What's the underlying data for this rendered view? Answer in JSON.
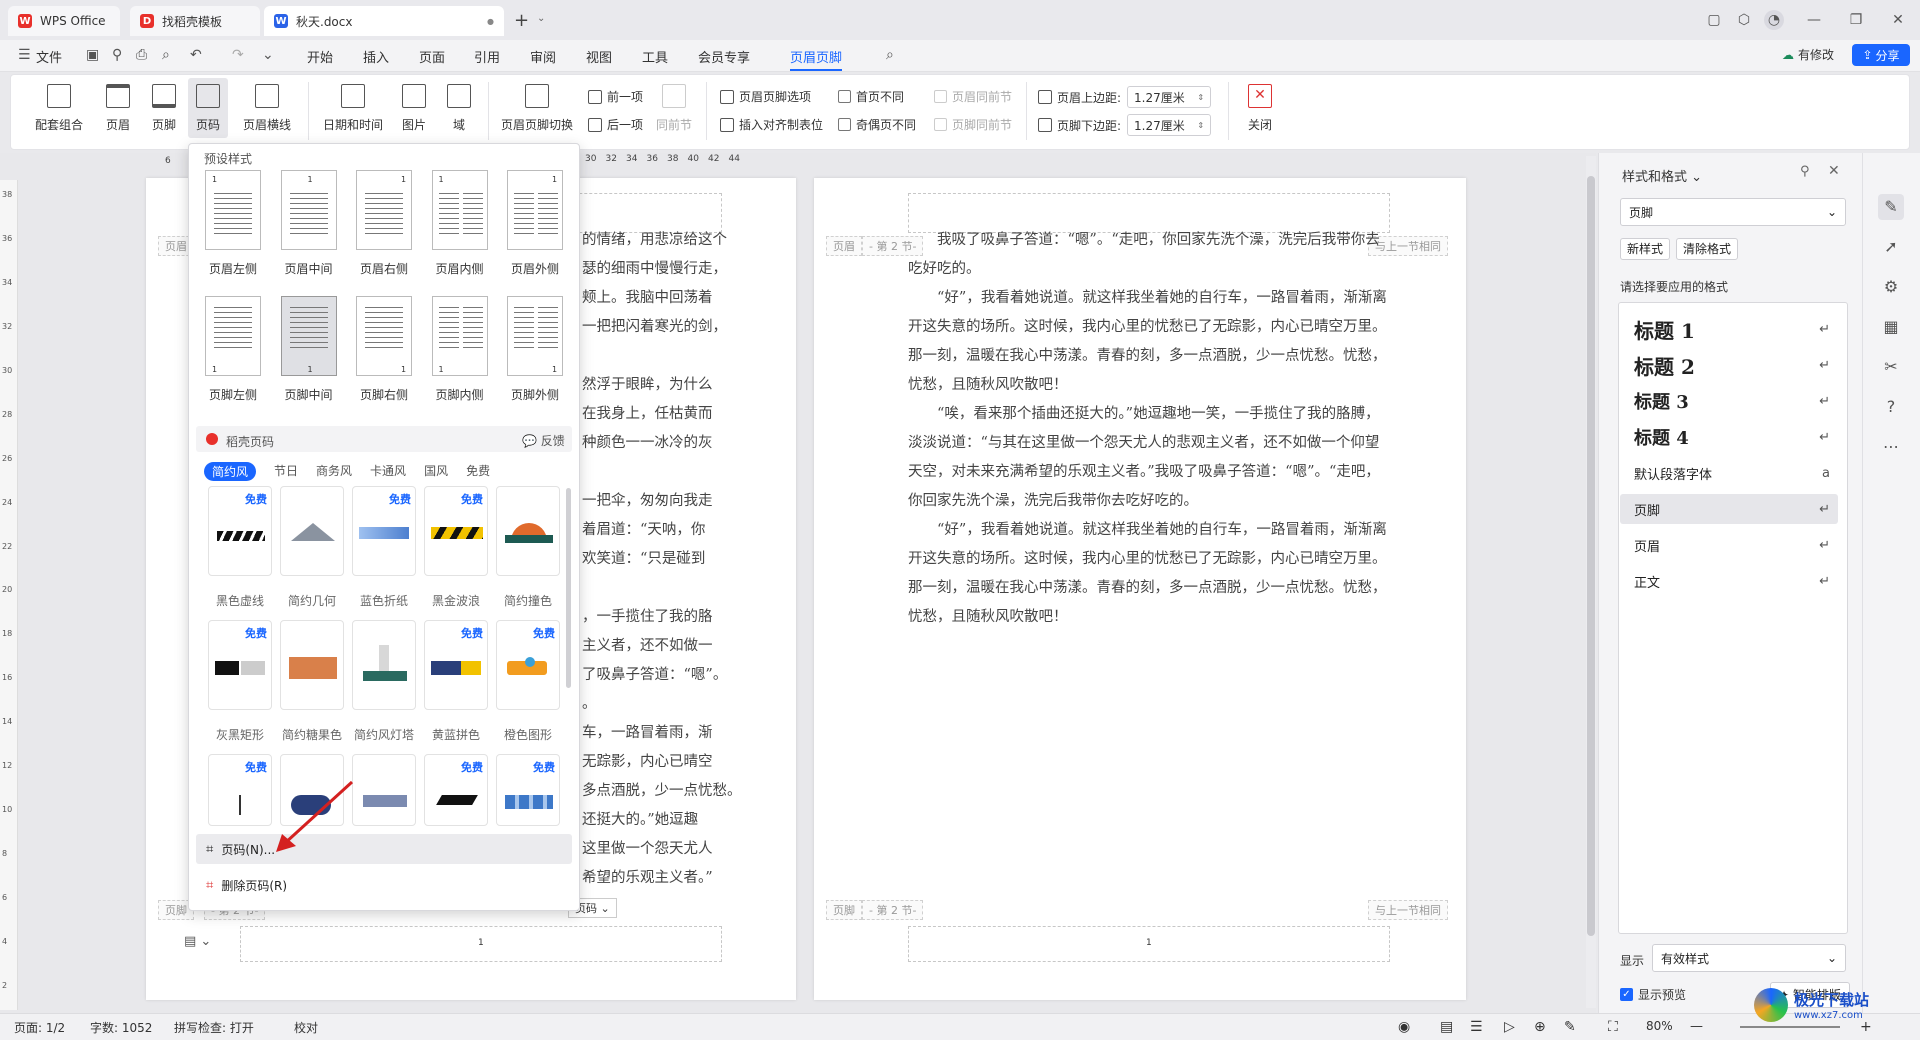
{
  "tabs": [
    {
      "label": "WPS Office",
      "logo": "W",
      "color": "#e8302b"
    },
    {
      "label": "找稻壳模板",
      "logo": "D",
      "color": "#e8302b"
    },
    {
      "label": "秋天.docx",
      "logo": "W",
      "color": "#2b63e8"
    }
  ],
  "menu": {
    "file": "文件",
    "items": [
      "开始",
      "插入",
      "页面",
      "引用",
      "审阅",
      "视图",
      "工具",
      "会员专享",
      "页眉页脚"
    ],
    "active": "页眉页脚",
    "modified": "有修改",
    "share": "分享"
  },
  "ribbon": {
    "big_buttons": [
      "配套组合",
      "页眉",
      "页脚",
      "页码",
      "页眉横线",
      "日期和时间",
      "图片",
      "域",
      "页眉页脚切换"
    ],
    "prev": "前一项",
    "next": "后一项",
    "same_as_prev": "同前节",
    "hf_options": "页眉页脚选项",
    "insert_align_tab": "插入对齐制表位",
    "first_page_diff": "首页不同",
    "odd_even_diff": "奇偶页不同",
    "header_same_prev": "页眉同前节",
    "footer_same_prev": "页脚同前节",
    "header_top_margin_label": "页眉上边距:",
    "header_top_margin": "1.27厘米",
    "footer_bottom_margin_label": "页脚下边距:",
    "footer_bottom_margin": "1.27厘米",
    "close": "关闭"
  },
  "ruler": {
    "left_mark": "6",
    "ticks": [
      "30",
      "32",
      "34",
      "36",
      "38",
      "40",
      "42",
      "44"
    ],
    "vertical": [
      "38",
      "36",
      "34",
      "32",
      "30",
      "28",
      "26",
      "24",
      "22",
      "20",
      "18",
      "16",
      "14",
      "12",
      "10",
      "8",
      "6",
      "4",
      "2"
    ]
  },
  "dropdown": {
    "preset_title": "预设样式",
    "header_presets": [
      "页眉左侧",
      "页眉中间",
      "页眉右侧",
      "页眉内侧",
      "页眉外侧"
    ],
    "footer_presets": [
      "页脚左侧",
      "页脚中间",
      "页脚右侧",
      "页脚内侧",
      "页脚外侧"
    ],
    "daoke_title": "稻壳页码",
    "feedback": "反馈",
    "filters": [
      "简约风",
      "节日",
      "商务风",
      "卡通风",
      "国风",
      "免费"
    ],
    "free_badge": "免费",
    "cards_row1": [
      "黑色虚线",
      "简约几何",
      "蓝色折纸",
      "黑金波浪",
      "简约撞色"
    ],
    "cards_row2": [
      "灰黑矩形",
      "简约糖果色",
      "简约风灯塔",
      "黄蓝拼色",
      "橙色图形"
    ],
    "page_number_cmd": "页码(N)...",
    "delete_page_number_cmd": "删除页码(R)"
  },
  "page1": {
    "header_tag": "页眉",
    "footer_tag": "页脚",
    "section_tag": "- 第 2 节-",
    "footer_num": "1",
    "page_btn": "页码",
    "lines": [
      "的情绪，用悲凉给这个",
      "瑟的细雨中慢慢行走，",
      "颊上。我脑中回荡着",
      "一把把闪着寒光的剑，",
      "",
      "然浮于眼眸，为什么",
      "在我身上，任枯黄而",
      "种颜色一一冰冷的灰",
      "",
      "一把伞，匆匆向我走",
      "着眉道：“天呐，你",
      "欢笑道：“只是碰到",
      "",
      "，一手揽住了我的胳",
      "主义者，还不如做一",
      "了吸鼻子答道：“嗯”。",
      "。",
      "车，一路冒着雨，渐",
      "无踪影，内心已晴空",
      "多点酒脱，少一点忧愁。",
      "还挺大的。”她逗趣",
      "这里做一个怨天尤人",
      "希望的乐观主义者。”"
    ]
  },
  "page2": {
    "header_tag": "页眉",
    "section_tag": "- 第 2 节-",
    "same_as_prev": "与上一节相同",
    "footer_tag": "页脚",
    "footer_num": "1",
    "paragraphs": [
      "我吸了吸鼻子答道：“嗯”。“走吧，你回家先洗个澡，洗完后我带你去吃好吃的。",
      "“好”，我看着她说道。就这样我坐着她的自行车，一路冒着雨，渐渐离开这失意的场所。这时候，我内心里的忧愁已了无踪影，内心已晴空万里。那一刻，温暖在我心中荡漾。青春的刻，多一点酒脱，少一点忧愁。忧愁，忧愁，且随秋风吹散吧！",
      "“唉，看来那个插曲还挺大的。”她逗趣地一笑，一手揽住了我的胳膊，淡淡说道：“与其在这里做一个怨天尤人的悲观主义者，还不如做一个仰望天空，对未来充满希望的乐观主义者。”我吸了吸鼻子答道：“嗯”。“走吧，你回家先洗个澡，洗完后我带你去吃好吃的。",
      "“好”，我看着她说道。就这样我坐着她的自行车，一路冒着雨，渐渐离开这失意的场所。这时候，我内心里的忧愁已了无踪影，内心已晴空万里。那一刻，温暖在我心中荡漾。青春的刻，多一点酒脱，少一点忧愁。忧愁，忧愁，且随秋风吹散吧！"
    ]
  },
  "right_panel": {
    "title": "样式和格式",
    "current_style": "页脚",
    "new_style": "新样式",
    "clear_format": "清除格式",
    "choose_label": "请选择要应用的格式",
    "styles": [
      "标题 1",
      "标题 2",
      "标题 3",
      "标题 4",
      "默认段落字体",
      "页脚",
      "页眉",
      "正文"
    ],
    "selected_style": "页脚",
    "show_label": "显示",
    "show_value": "有效样式",
    "preview_label": "显示预览",
    "smart_layout": "智能排版"
  },
  "status": {
    "page": "页面: 1/2",
    "words": "字数: 1052",
    "spell": "拼写检查: 打开",
    "proof": "校对",
    "zoom": "80%"
  },
  "watermark": "极光下载站",
  "watermark_url": "www.xz7.com"
}
